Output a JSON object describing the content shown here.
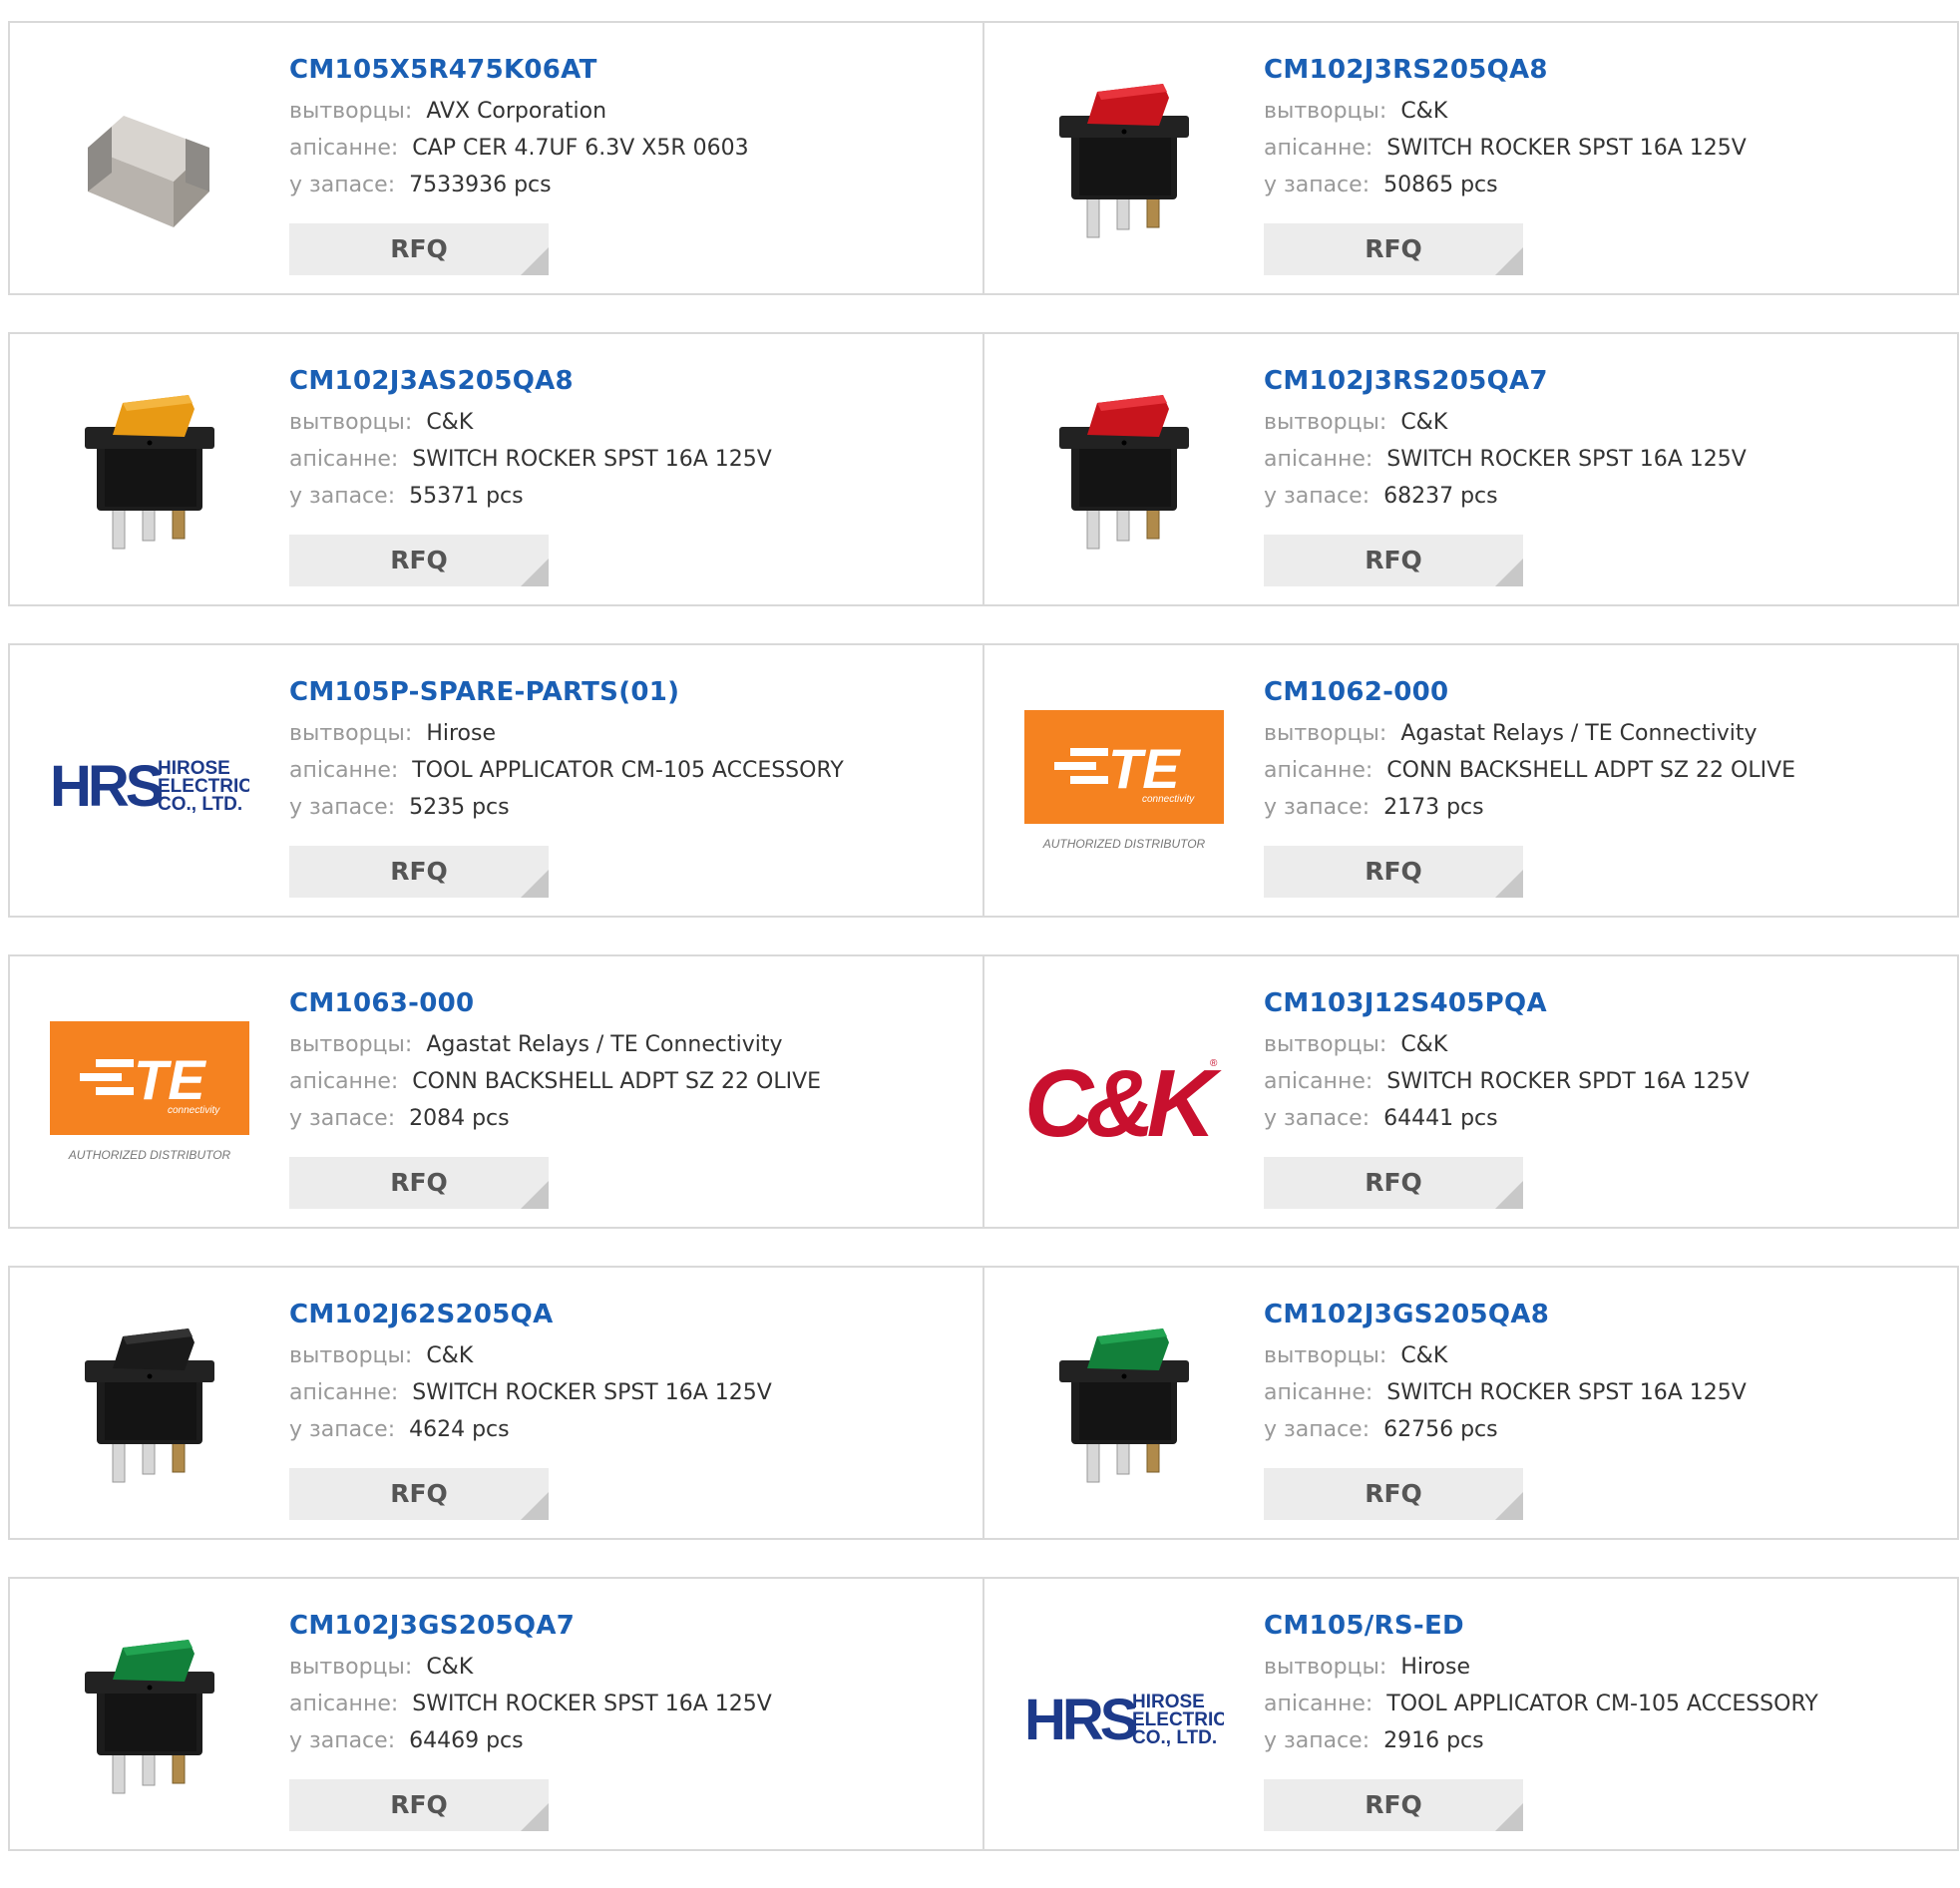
{
  "labels": {
    "manufacturer": "вытворцы:",
    "description": "апісанне:",
    "stock": "у запасе:",
    "rfq": "RFQ"
  },
  "brand_logos": {
    "hrs": {
      "mark": "HRS",
      "line1": "HIROSE",
      "line2": "ELECTRIC",
      "line3": "CO., LTD."
    },
    "te": {
      "mark": "TE",
      "sub": "connectivity",
      "caption": "AUTHORIZED DISTRIBUTOR"
    },
    "ck": {
      "mark": "C&K",
      "reg": "®"
    }
  },
  "colors": {
    "link": "#1a5fb4",
    "te_orange": "#f58220",
    "hrs_blue": "#1d3a8a",
    "ck_red": "#c8102e"
  },
  "products": [
    {
      "part": "CM105X5R475K06AT",
      "manufacturer": "AVX Corporation",
      "description": "CAP CER 4.7UF 6.3V X5R 0603",
      "stock": "7533936 pcs",
      "image": "capacitor-image"
    },
    {
      "part": "CM102J3RS205QA8",
      "manufacturer": "C&K",
      "description": "SWITCH ROCKER SPST 16A 125V",
      "stock": "50865 pcs",
      "image": "red-switch-image"
    },
    {
      "part": "CM102J3AS205QA8",
      "manufacturer": "C&K",
      "description": "SWITCH ROCKER SPST 16A 125V",
      "stock": "55371 pcs",
      "image": "amber-switch-image"
    },
    {
      "part": "CM102J3RS205QA7",
      "manufacturer": "C&K",
      "description": "SWITCH ROCKER SPST 16A 125V",
      "stock": "68237 pcs",
      "image": "red-switch-image"
    },
    {
      "part": "CM105P-SPARE-PARTS(01)",
      "manufacturer": "Hirose",
      "description": "TOOL APPLICATOR CM-105 ACCESSORY",
      "stock": "5235 pcs",
      "image": "hirose-logo"
    },
    {
      "part": "CM1062-000",
      "manufacturer": "Agastat Relays / TE Connectivity",
      "description": "CONN BACKSHELL ADPT SZ 22 OLIVE",
      "stock": "2173 pcs",
      "image": "te-logo"
    },
    {
      "part": "CM1063-000",
      "manufacturer": "Agastat Relays / TE Connectivity",
      "description": "CONN BACKSHELL ADPT SZ 22 OLIVE",
      "stock": "2084 pcs",
      "image": "te-logo"
    },
    {
      "part": "CM103J12S405PQA",
      "manufacturer": "C&K",
      "description": "SWITCH ROCKER SPDT 16A 125V",
      "stock": "64441 pcs",
      "image": "ck-logo"
    },
    {
      "part": "CM102J62S205QA",
      "manufacturer": "C&K",
      "description": "SWITCH ROCKER SPST 16A 125V",
      "stock": "4624 pcs",
      "image": "black-switch-image"
    },
    {
      "part": "CM102J3GS205QA8",
      "manufacturer": "C&K",
      "description": "SWITCH ROCKER SPST 16A 125V",
      "stock": "62756 pcs",
      "image": "green-switch-image"
    },
    {
      "part": "CM102J3GS205QA7",
      "manufacturer": "C&K",
      "description": "SWITCH ROCKER SPST 16A 125V",
      "stock": "64469 pcs",
      "image": "green-switch-image"
    },
    {
      "part": "CM105/RS-ED",
      "manufacturer": "Hirose",
      "description": "TOOL APPLICATOR CM-105 ACCESSORY",
      "stock": "2916 pcs",
      "image": "hirose-logo"
    }
  ]
}
